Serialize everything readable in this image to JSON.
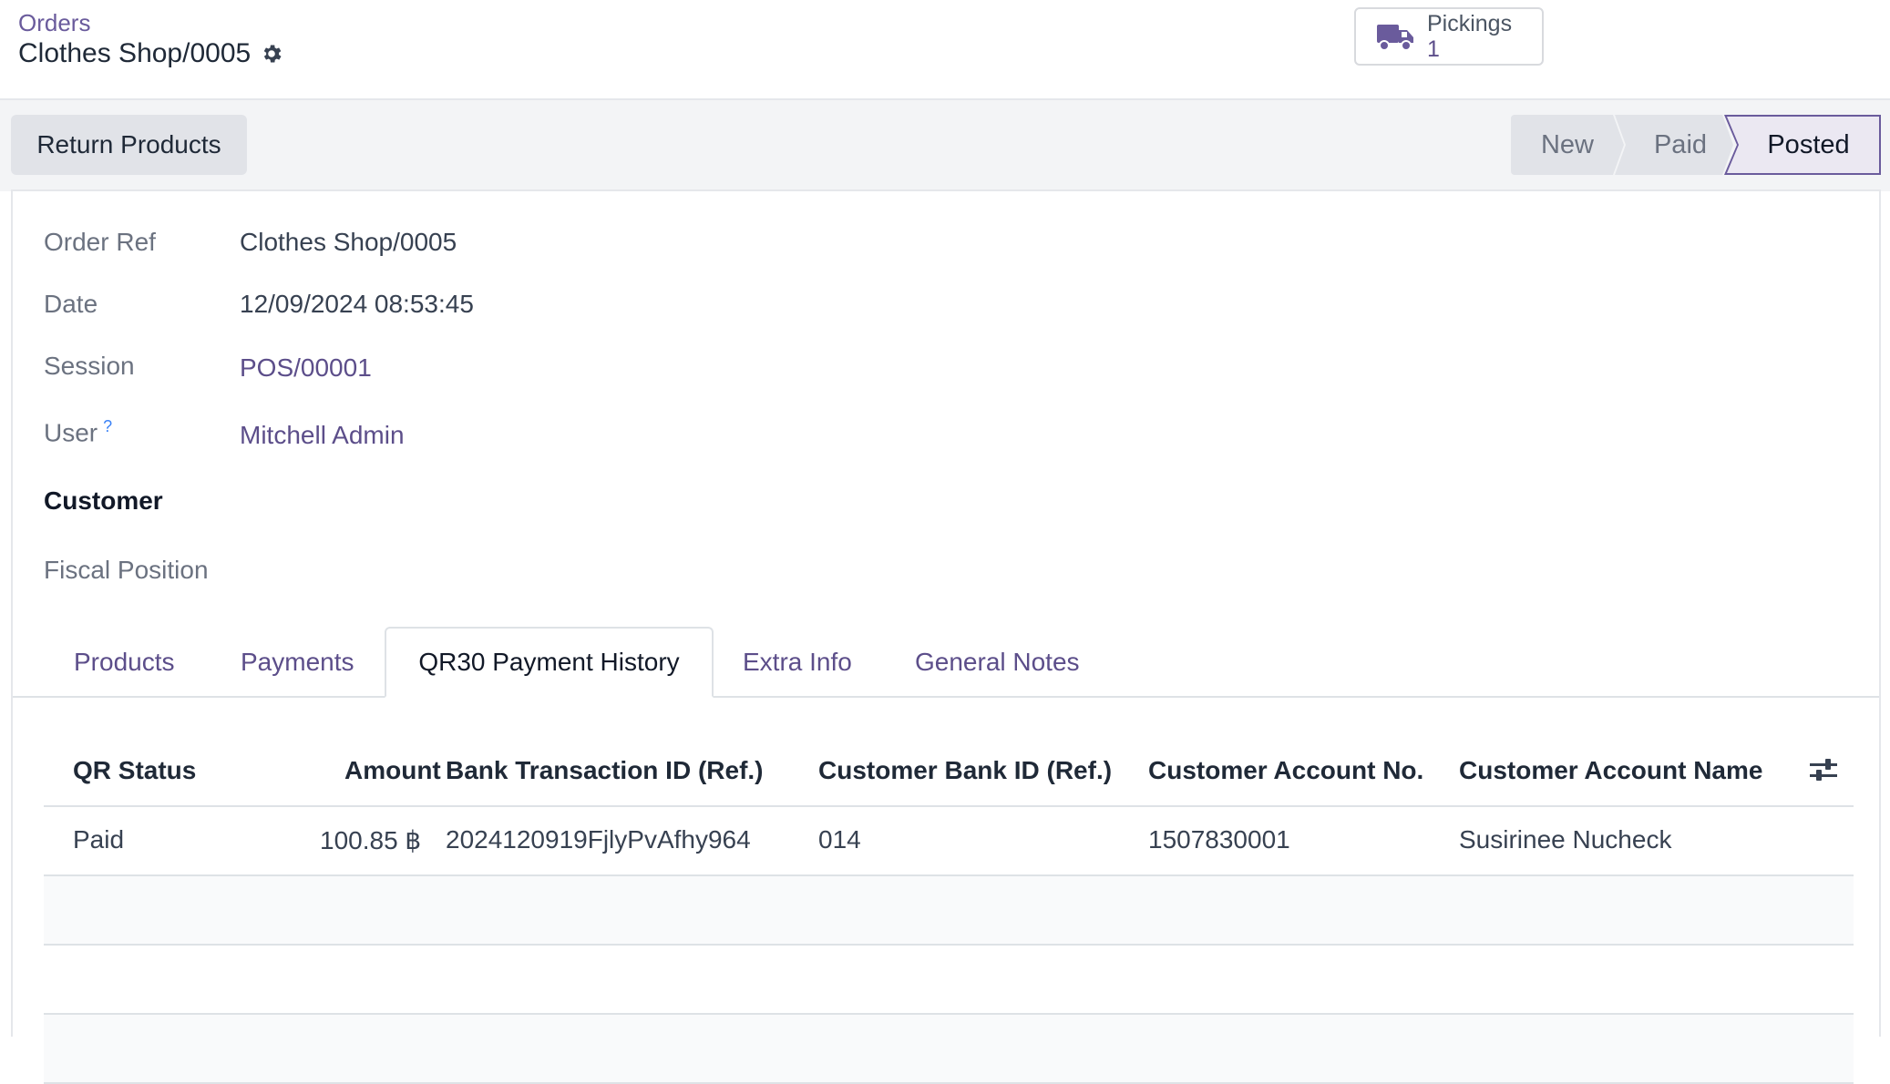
{
  "breadcrumb": {
    "parent": "Orders",
    "current": "Clothes Shop/0005"
  },
  "smart_button": {
    "icon": "truck-icon",
    "label": "Pickings",
    "value": "1"
  },
  "actions": {
    "return_products": "Return Products"
  },
  "statusbar": {
    "stages": [
      "New",
      "Paid",
      "Posted"
    ],
    "active": "Posted"
  },
  "fields": {
    "order_ref": {
      "label": "Order Ref",
      "value": "Clothes Shop/0005"
    },
    "date": {
      "label": "Date",
      "value": "12/09/2024 08:53:45"
    },
    "session": {
      "label": "Session",
      "value": "POS/00001"
    },
    "user": {
      "label": "User",
      "help": "?",
      "value": "Mitchell Admin"
    },
    "customer": {
      "label": "Customer",
      "value": ""
    },
    "fiscal_position": {
      "label": "Fiscal Position",
      "value": ""
    }
  },
  "tabs": [
    {
      "label": "Products"
    },
    {
      "label": "Payments"
    },
    {
      "label": "QR30 Payment History"
    },
    {
      "label": "Extra Info"
    },
    {
      "label": "General Notes"
    }
  ],
  "active_tab": "QR30 Payment History",
  "table": {
    "columns": [
      "QR Status",
      "Amount",
      "Bank Transaction ID (Ref.)",
      "Customer Bank ID (Ref.)",
      "Customer Account No.",
      "Customer Account Name"
    ],
    "rows": [
      [
        "Paid",
        "100.85 ฿",
        "2024120919FjlyPvAfhy964",
        "014",
        "1507830001",
        "Susirinee Nucheck"
      ]
    ]
  },
  "colors": {
    "accent": "#5c4e8a",
    "active_stage_border": "#6a5b9c",
    "active_stage_bg": "#ebe8f2"
  }
}
